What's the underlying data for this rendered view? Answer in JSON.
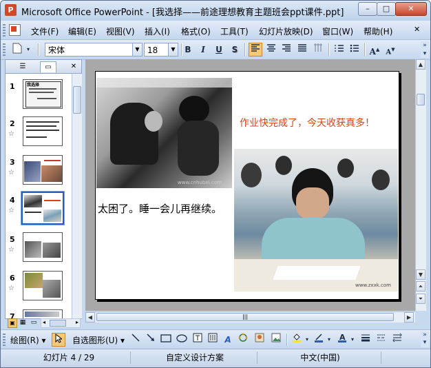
{
  "window": {
    "title": "Microsoft Office PowerPoint - [我选择——前途理想教育主题班会ppt课件.ppt]",
    "app_icon_letter": "P",
    "minimize": "–",
    "maximize": "□",
    "close": "✕"
  },
  "menu": {
    "items": [
      "文件(F)",
      "编辑(E)",
      "视图(V)",
      "插入(I)",
      "格式(O)",
      "工具(T)",
      "幻灯片放映(D)",
      "窗口(W)",
      "帮助(H)"
    ],
    "close_doc": "✕"
  },
  "format_toolbar": {
    "font_name": "宋体",
    "font_size": "18",
    "bold": "B",
    "italic": "I",
    "underline": "U",
    "shadow": "S",
    "grow_font": "A",
    "shrink_font": "A"
  },
  "pane_tabs": {
    "outline": "☰",
    "slides": "▭",
    "close": "✕"
  },
  "slides": [
    {
      "number": "1",
      "has_animation": false
    },
    {
      "number": "2",
      "has_animation": true
    },
    {
      "number": "3",
      "has_animation": true
    },
    {
      "number": "4",
      "has_animation": true
    },
    {
      "number": "5",
      "has_animation": true
    },
    {
      "number": "6",
      "has_animation": true
    },
    {
      "number": "7",
      "has_animation": false
    }
  ],
  "slide_thumb_1_text": "我选择",
  "slide_content": {
    "caption_top_right": "作业快完成了，今天收获真多！",
    "caption_left": "太困了。睡一会儿再继续。",
    "watermark_1": "www.cnhubei.com",
    "watermark_2": "www.zxxk.com",
    "caption_color": "#d8431c"
  },
  "drawing_toolbar": {
    "draw_menu": "绘图(R)",
    "autoshapes_menu": "自选图形(U)"
  },
  "status": {
    "slide": "幻灯片 4 / 29",
    "design": "自定义设计方案",
    "language": "中文(中国)"
  },
  "scroll": {
    "hscroll_grip": "|||",
    "vscroll_grip": "≡"
  }
}
